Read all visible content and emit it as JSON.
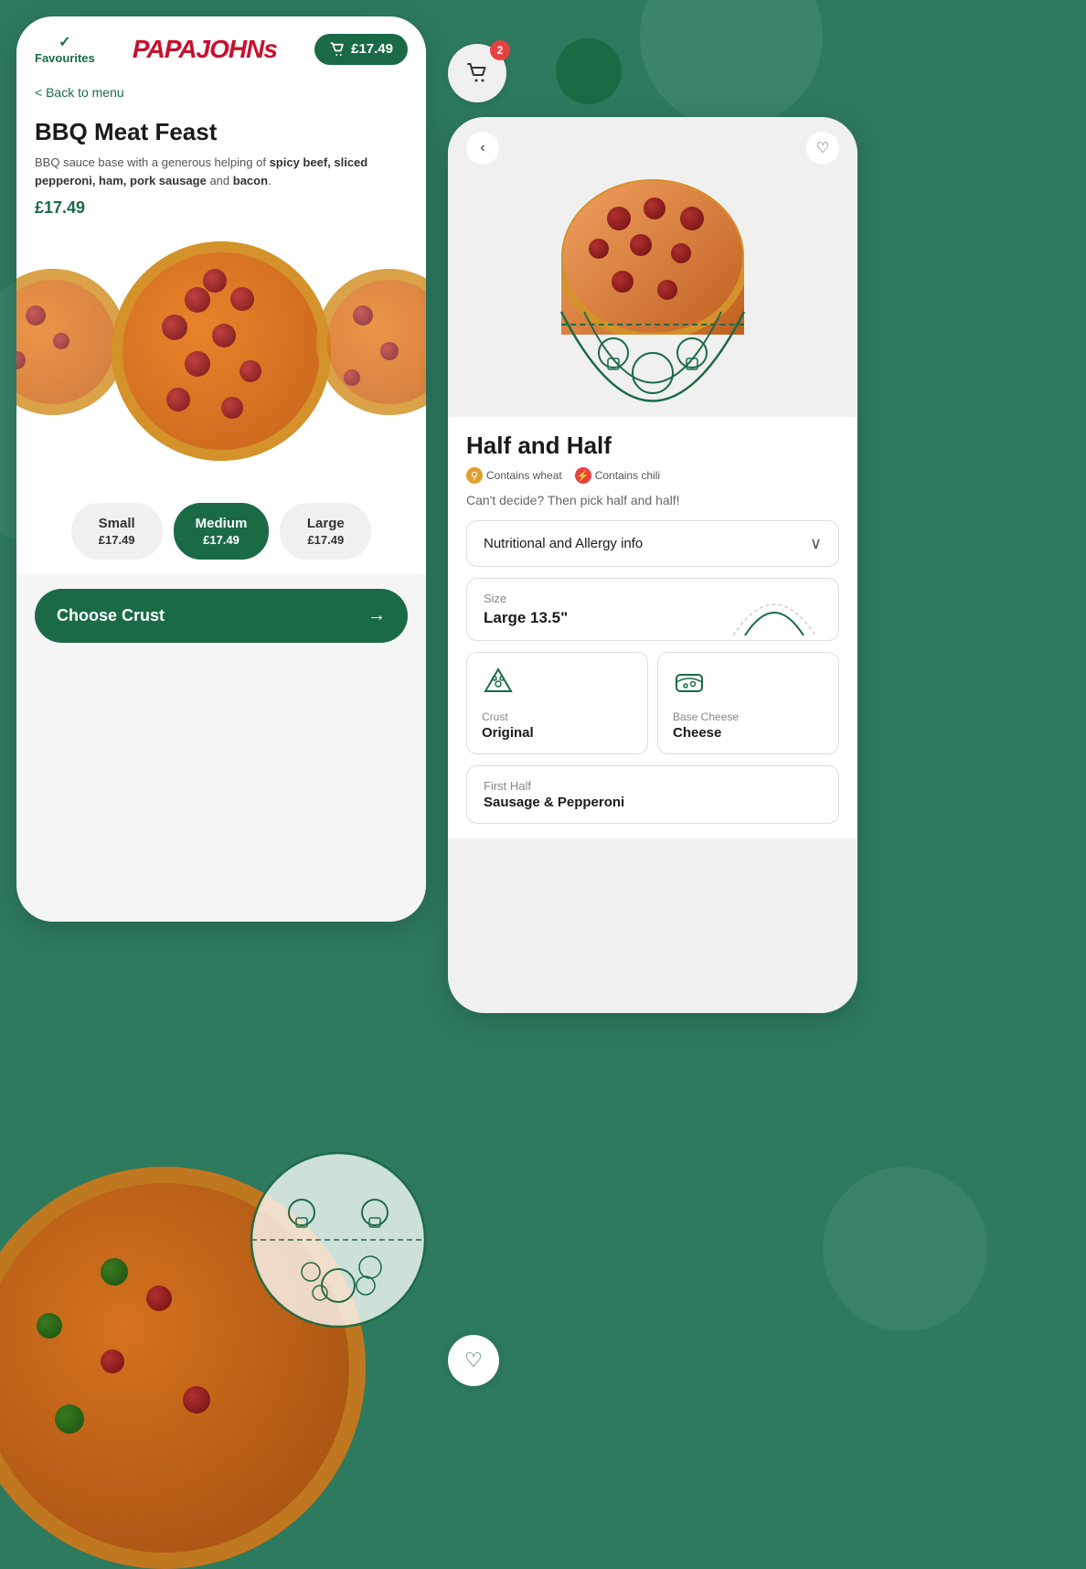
{
  "app": {
    "brand": "PAPAJOHNs",
    "bg_color": "#2d7a5f"
  },
  "left_phone": {
    "header": {
      "favourites_label": "Favourites",
      "cart_price": "£17.49"
    },
    "back_link": "< Back to menu",
    "product": {
      "title": "BBQ Meat Feast",
      "description_pre": "BBQ sauce base with a generous helping of ",
      "description_bold": "spicy beef, sliced pepperoni, ham, pork sausage",
      "description_and": " and ",
      "description_end": "bacon",
      "description_period": ".",
      "price": "£17.49"
    },
    "sizes": [
      {
        "name": "Small",
        "price": "£17.49",
        "active": false
      },
      {
        "name": "Medium",
        "price": "£17.49",
        "active": true
      },
      {
        "name": "Large",
        "price": "£17.49",
        "active": false
      }
    ],
    "cta_label": "Choose Crust"
  },
  "right_phone": {
    "back_icon": "‹",
    "heart_icon": "♡",
    "product": {
      "title": "Half and Half",
      "allergens": [
        {
          "label": "Contains wheat",
          "icon": "🌾",
          "type": "wheat"
        },
        {
          "label": "Contains chili",
          "icon": "🌶",
          "type": "chili"
        }
      ],
      "description": "Can't decide? Then pick half and half!"
    },
    "nutritional_label": "Nutritional and Allergy info",
    "size_section": {
      "label": "Size",
      "value": "Large 13.5\""
    },
    "customizations": [
      {
        "label": "Crust",
        "value": "Original",
        "icon_type": "pizza-slice"
      },
      {
        "label": "Base Cheese",
        "value": "Cheese",
        "icon_type": "cheese"
      }
    ],
    "first_half": {
      "label": "First Half",
      "value": "Sausage & Pepperoni"
    }
  },
  "floating": {
    "cart_count": "2",
    "heart_icon": "♡"
  }
}
